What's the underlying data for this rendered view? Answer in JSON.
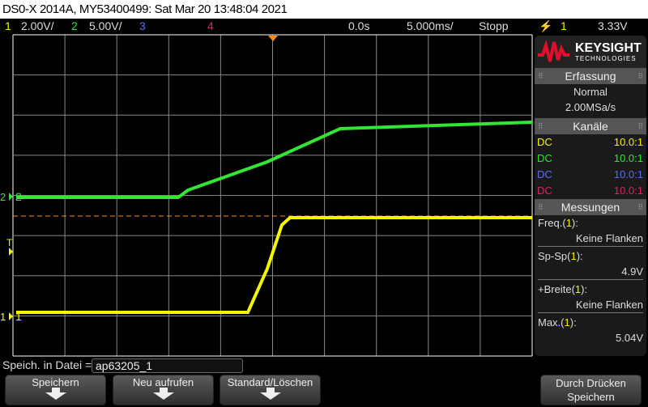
{
  "title": "DS0-X 2014A, MY53400499: Sat Mar 20 13:48:04 2021",
  "status": {
    "ch1_num": "1",
    "ch1_scale": "2.00V/",
    "ch2_num": "2",
    "ch2_scale": "5.00V/",
    "ch3_num": "3",
    "ch4_num": "4",
    "delay": "0.0s",
    "timebase": "5.000ms/",
    "run_state": "Stopp",
    "trigger_source": "1",
    "trigger_level": "3.33V"
  },
  "colors": {
    "ch1": "#f5f500",
    "ch2": "#33e633",
    "ch3": "#5a6cff",
    "ch4": "#e0245c",
    "trigger": "#ff8c1a"
  },
  "markers": {
    "ch1": "1",
    "ch2": "2",
    "trig": "T"
  },
  "panel": {
    "brand": "KEYSIGHT",
    "brand_sub": "TECHNOLOGIES",
    "acq_header": "Erfassung",
    "acq_mode": "Normal",
    "acq_rate": "2.00MSa/s",
    "channels_header": "Kanäle",
    "channels": [
      {
        "coupling": "DC",
        "probe": "10.0:1"
      },
      {
        "coupling": "DC",
        "probe": "10.0:1"
      },
      {
        "coupling": "DC",
        "probe": "10.0:1"
      },
      {
        "coupling": "DC",
        "probe": "10.0:1"
      }
    ],
    "meas_header": "Messungen",
    "measurements": [
      {
        "name": "Freq.",
        "src": "1",
        "value": "Keine Flanken"
      },
      {
        "name": "Sp-Sp",
        "src": "1",
        "value": "4.9V"
      },
      {
        "name": "+Breite",
        "src": "1",
        "value": "Keine Flanken"
      },
      {
        "name": "Max.",
        "src": "1",
        "value": "5.04V"
      }
    ]
  },
  "file": {
    "label": "Speich. in Datei =",
    "value": "ap63205_1"
  },
  "softkeys": [
    "Speichern",
    "Neu aufrufen",
    "Standard/Löschen"
  ],
  "right_key": {
    "line1": "Durch Drücken",
    "line2": "Speichern"
  }
}
